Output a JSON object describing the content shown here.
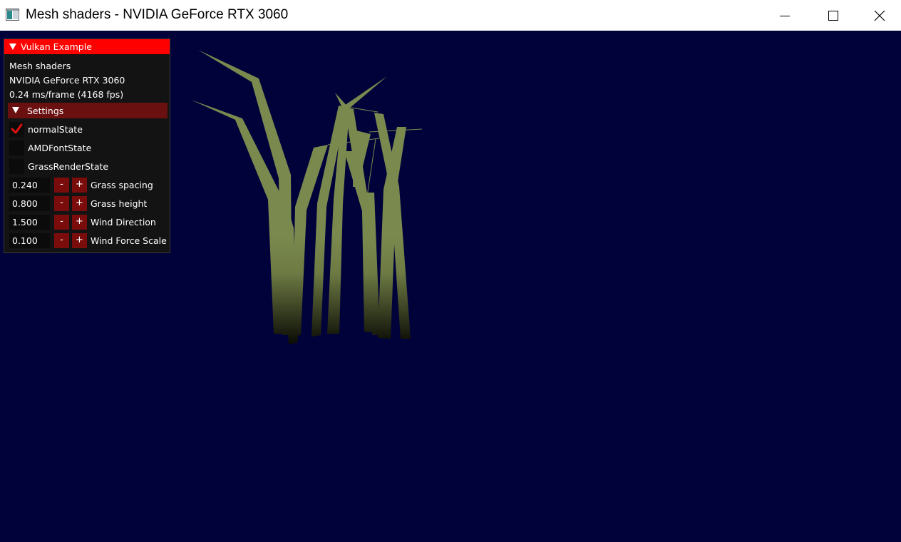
{
  "window": {
    "title": "Mesh shaders - NVIDIA GeForce RTX 3060",
    "icon": "app-window-icon",
    "controls": [
      "minimize-icon",
      "maximize-icon",
      "close-icon"
    ]
  },
  "colors": {
    "viewport_bg": "#02023a",
    "grass_top": "#7a8a4e",
    "grass_bottom": "#0d0e06",
    "panel_header": "#ff0000",
    "settings_header": "#6b1010",
    "button": "#7a0c0c",
    "checkmark": "#e01010"
  },
  "overlay": {
    "header": "Vulkan Example",
    "lines": [
      "Mesh shaders",
      "NVIDIA GeForce RTX 3060",
      "0.24 ms/frame (4168 fps)"
    ],
    "settings": {
      "header": "Settings",
      "checkboxes": [
        {
          "label": "normalState",
          "checked": true
        },
        {
          "label": "AMDFontState",
          "checked": false
        },
        {
          "label": "GrassRenderState",
          "checked": false
        }
      ],
      "steppers": [
        {
          "value": "0.240",
          "label": "Grass spacing",
          "minus": "-",
          "plus": "+"
        },
        {
          "value": "0.800",
          "label": "Grass height",
          "minus": "-",
          "plus": "+"
        },
        {
          "value": "1.500",
          "label": "Wind Direction",
          "minus": "-",
          "plus": "+"
        },
        {
          "value": "0.100",
          "label": "Wind Force Scale",
          "minus": "-",
          "plus": "+"
        }
      ]
    }
  }
}
